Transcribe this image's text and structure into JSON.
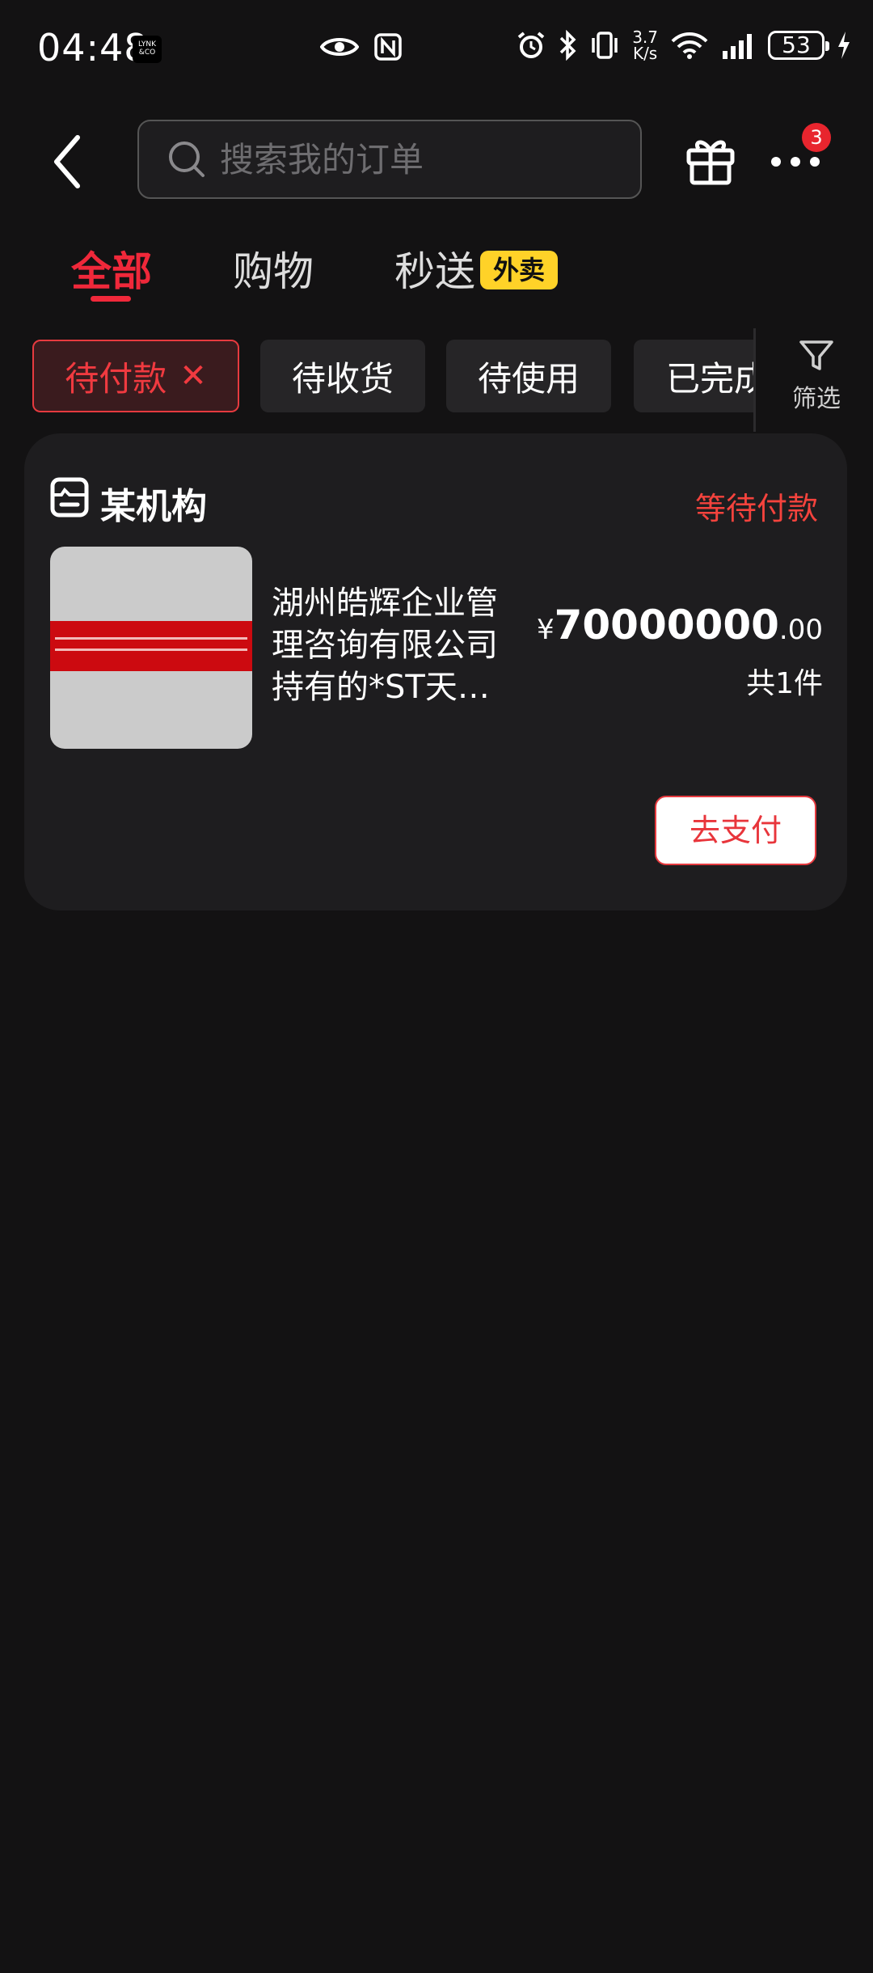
{
  "status_bar": {
    "time": "04:48",
    "logo_text": "LYNK&CO",
    "net_speed_value": "3.7",
    "net_speed_unit": "K/s",
    "battery": "53"
  },
  "header": {
    "search_placeholder": "搜索我的订单",
    "notification_count": "3"
  },
  "tabs": [
    {
      "label": "全部",
      "active": true
    },
    {
      "label": "购物",
      "active": false
    },
    {
      "label": "秒送",
      "active": false,
      "tag": "外卖"
    }
  ],
  "filters": [
    {
      "label": "待付款",
      "active": true
    },
    {
      "label": "待收货",
      "active": false
    },
    {
      "label": "待使用",
      "active": false
    },
    {
      "label": "已完成",
      "active": false
    }
  ],
  "filter_button_label": "筛选",
  "order": {
    "shop_name": "某机构",
    "status": "等待付款",
    "product_title": "湖州皓辉企业管理咨询有限公司持有的*ST天…",
    "price_currency": "¥",
    "price_integer": "70000000",
    "price_decimal": ".00",
    "quantity_text": "共1件",
    "pay_button_label": "去支付"
  },
  "colors": {
    "accent": "#f0283a",
    "background": "#131213",
    "card": "#1e1d1f",
    "tag_yellow": "#ffd228"
  }
}
